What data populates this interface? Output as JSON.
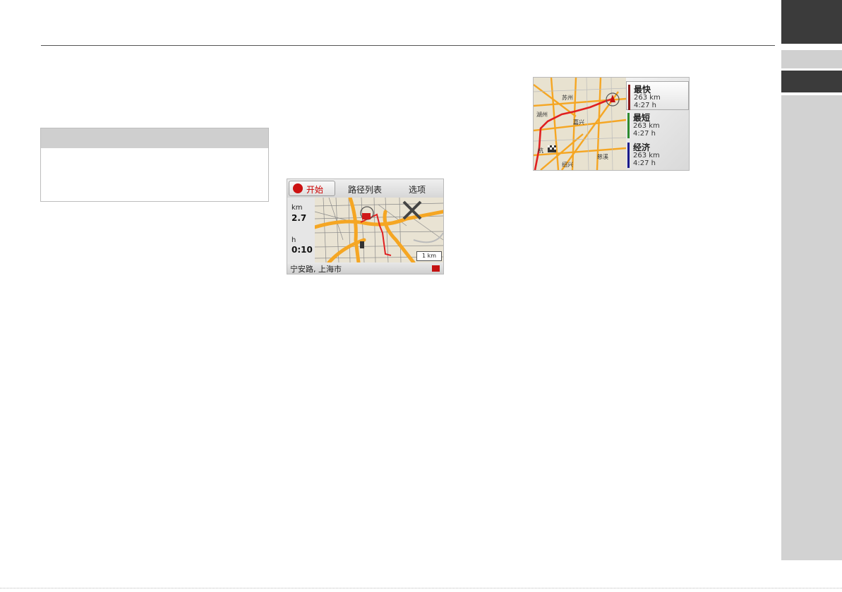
{
  "nav_screen": {
    "start_label": "开始",
    "tabs": [
      "路径列表",
      "选项"
    ],
    "distance_unit": "km",
    "distance_value": "2.7",
    "time_unit": "h",
    "time_value": "0:10",
    "scale_label": "1 km",
    "address": "宁安路, 上海市"
  },
  "route_screen": {
    "routes": [
      {
        "name": "最快",
        "distance": "263 km",
        "time": "4:27 h",
        "color": "#8b1a1a"
      },
      {
        "name": "最短",
        "distance": "263 km",
        "time": "4:27 h",
        "color": "#2e8b2e"
      },
      {
        "name": "经济",
        "distance": "263 km",
        "time": "4:27 h",
        "color": "#1a1a8b"
      }
    ],
    "map_labels": [
      "苏州",
      "湖州",
      "嘉兴",
      "杭",
      "慈溪",
      "绍兴"
    ]
  },
  "colors": {
    "road": "#f5a623",
    "route": "#e02020",
    "tab_dark": "#3b3b3b",
    "tab_light": "#d2d2d2"
  }
}
